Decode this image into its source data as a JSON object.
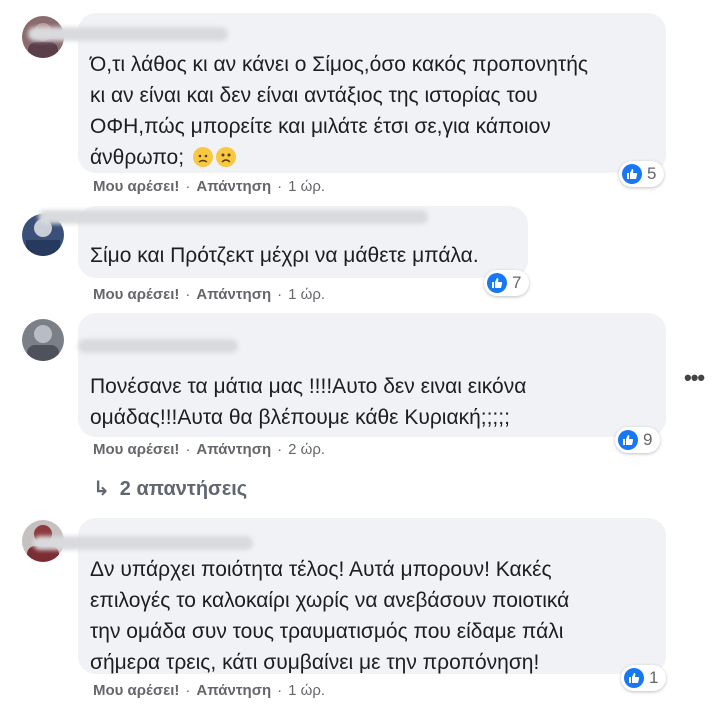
{
  "comments": [
    {
      "text_lines": [
        "Ό,τι λάθος κι αν κάνει ο Σίμος,όσο κακός προπονητής",
        "κι αν είναι και δεν είναι αντάξιος της ιστορίας του",
        "ΟΦΗ,πώς μπορείτε και μιλάτε έτσι σε,για κάποιον",
        "άνθρωπο;"
      ],
      "emojis": [
        "disappointed-face-emoji",
        "sad-face-emoji"
      ],
      "like_label": "Μου αρέσει!",
      "reply_label": "Απάντηση",
      "time": "1 ώρ.",
      "reactions": "5"
    },
    {
      "text_lines": [
        "Σίμο και Πρότζεκτ μέχρι να μάθετε μπάλα."
      ],
      "like_label": "Μου αρέσει!",
      "reply_label": "Απάντηση",
      "time": "1 ώρ.",
      "reactions": "7"
    },
    {
      "text_lines": [
        "Πονέσανε τα μάτια μας !!!!Αυτο δεν ειναι εικόνα",
        "ομάδας!!!Αυτα θα βλέπουμε κάθε Κυριακή;;;;;"
      ],
      "like_label": "Μου αρέσει!",
      "reply_label": "Απάντηση",
      "time": "2 ώρ.",
      "reactions": "9",
      "replies_label": "2 απαντήσεις"
    },
    {
      "text_lines": [
        "Δν υπάρχει ποιότητα τέλος! Αυτά μπορουν! Κακές",
        "επιλογές το καλοκαίρι χωρίς να ανεβάσουν ποιοτικά",
        "την ομάδα συν τους τραυματισμός που είδαμε πάλι",
        "σήμερα τρεις, κάτι συμβαίνει με την προπόνηση!"
      ],
      "like_label": "Μου αρέσει!",
      "reply_label": "Απάντηση",
      "time": "1 ώρ.",
      "reactions": "1"
    }
  ],
  "colors": {
    "bubble": "#f0f2f5",
    "text": "#1c1e21",
    "meta": "#65676b",
    "like_blue": "#1877f2"
  },
  "icons": {
    "more_options": "more-options-icon",
    "reply_arrow": "reply-arrow-icon",
    "like": "like-icon"
  },
  "more_glyph": "•••",
  "reply_arrow_glyph": "↳"
}
